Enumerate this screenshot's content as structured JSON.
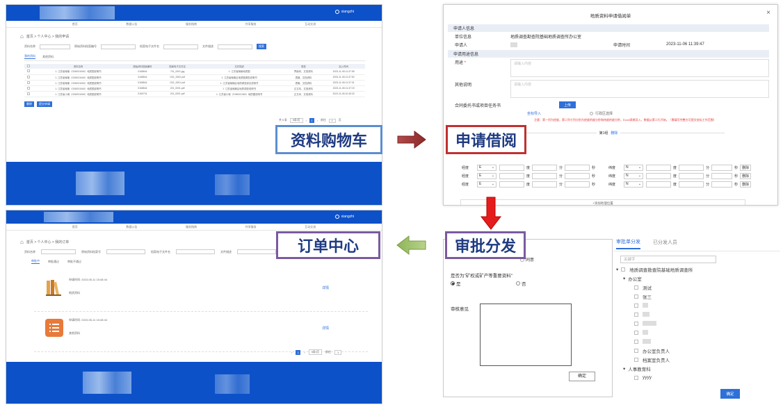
{
  "labels": {
    "cart": "资料购物车",
    "apply": "申请借阅",
    "approve": "审批分发",
    "order": "订单中心"
  },
  "panel1": {
    "user": "xiangzhi",
    "nav": [
      "首页",
      "数据公告",
      "服务指南",
      "共享服务",
      "互动交流"
    ],
    "breadcrumb": "首页  >  个人中心  >  我的申请",
    "filters": [
      "资料名称",
      "原始资料档案编号",
      "档案电子文件名",
      "文件描述"
    ],
    "search_btn": "搜索",
    "tabs": [
      "我的资料",
      "其他资料"
    ],
    "columns": [
      "资料名称",
      "原始资料档案编号",
      "档案电子文件名",
      "文件描述",
      "类型",
      "加入时间"
    ],
    "rows": [
      [
        "1. 江苏省赣榆（G08G01060）地质图说明书",
        "0168844",
        "701_0001.jpg",
        "1. 江苏省赣榆地质图",
        "界面块、文档资料",
        "2023-11-06 11:37:55"
      ],
      [
        "1. 江苏省赣榆（G08G01060）地质图说明书",
        "0168844",
        "G01_0002.pdf",
        "1. 江苏省赣榆区地质图调查说明书",
        "表格、文档资料",
        "2023-11-06 11:37:52"
      ],
      [
        "1. 江苏省赣榆（G08G01060）地质图说明书",
        "0168844",
        "G01_0001.pdf",
        "1. 江苏省赣榆区地质调查综合说明书",
        "表格、文档资料",
        "2023-11-06 11:37:31"
      ],
      [
        "1. 江苏省赣榆（G08G01060）地质图说明书",
        "0168844",
        "201_0001.pdf",
        "1. 江苏省赣榆区地质调查说明书",
        "正文本、文档资料",
        "2023-11-06 11:37:19"
      ],
      [
        "1. 江苏省小城（G08G01060）地质图说明书",
        "0160701",
        "201_0001.pdf",
        "1. 江苏省小城（G08G01060）地质图说明书",
        "正文本、文档资料",
        "2023-11-06 10:45:32"
      ]
    ],
    "actions": [
      "删除",
      "提交申请"
    ],
    "pager": [
      "共 5 条",
      "5条/页",
      "1",
      "前往",
      "1",
      "页"
    ]
  },
  "dialog": {
    "title": "地质资料申请借阅单",
    "close": "×",
    "sec_applicant": "申请人信息",
    "unit_label": "单位信息",
    "unit_value": "地质调查勘查院基础地质调查所办公室",
    "person_label": "申请人",
    "time_label": "申请时间",
    "time_value": "2023-11-06 11:39:47",
    "sec_purpose": "申请用途信息",
    "purpose_label": "用途",
    "purpose_ph": "请输入内容",
    "other_label": "其他说明",
    "other_ph": "请输入内容",
    "contract_label": "合同委托书或项目任务书",
    "upload_btn": "上传",
    "import_link": "坐标导入",
    "region_opt": "行政区选择",
    "red_note": "注意：第一列为经度，第二列七列分别为经度的度分秒和纬度的度分秒，Excel表格导入，数据从第二行开始。（需填写完整方可提交坐标工作范围）",
    "group_label": "第1组",
    "delete_group": "删除",
    "coord_rows": [
      {
        "lng": "经度",
        "dir1": "E",
        "deg": "度",
        "min": "分",
        "sec": "秒",
        "lat": "纬度",
        "dir2": "N",
        "del": "删除"
      },
      {
        "lng": "经度",
        "dir1": "E",
        "deg": "度",
        "min": "分",
        "sec": "秒",
        "lat": "纬度",
        "dir2": "N",
        "del": "删除"
      },
      {
        "lng": "经度",
        "dir1": "E",
        "deg": "度",
        "min": "分",
        "sec": "秒",
        "lat": "纬度",
        "dir2": "N",
        "del": "删除"
      }
    ],
    "add_group": "+添加地理位置"
  },
  "panel3": {
    "user": "xiangzhi",
    "nav": [
      "首页",
      "数据公告",
      "服务指南",
      "共享服务",
      "互动交流"
    ],
    "breadcrumb": "首页  >  个人中心  >  我的订单",
    "filters": [
      "资料名称",
      "原始资料档案号",
      "档案电子文件名",
      "文件描述"
    ],
    "tabs": [
      "审批中",
      "审批通过",
      "审批不通过"
    ],
    "orders": [
      {
        "time": "申请时间: 2023-05-11 15:48:44",
        "name": "地质资料",
        "detail": "详情"
      },
      {
        "time": "申请时间: 2023-05-11 15:48:44",
        "name": "其他资料",
        "detail": "详情"
      }
    ],
    "pager": [
      "1",
      "5条/页",
      "前往",
      "1"
    ]
  },
  "approve": {
    "agree_opt": "同意",
    "question": "是否为\"矿权或矿产等重要资料\"",
    "yes": "是",
    "no": "否",
    "opinion_label": "审核意见",
    "confirm": "确定"
  },
  "tree": {
    "tab_active": "审批单分发",
    "tab_other": "已分发人员",
    "search_ph": "关键字",
    "root": "地质调查勘查院基础地质调查所",
    "office": "办公室",
    "members": [
      "测试",
      "张三",
      "",
      "",
      "",
      "",
      ""
    ],
    "office_heads": [
      "办公室负责人",
      "档案室负责人"
    ],
    "hr": "人事教育科",
    "hr_member": "yyyy",
    "confirm": "确定"
  }
}
